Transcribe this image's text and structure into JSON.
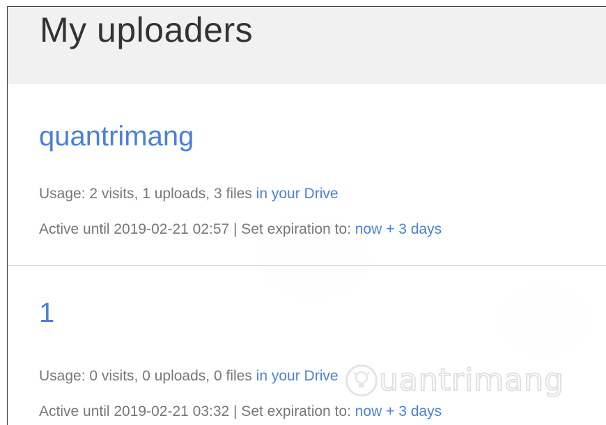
{
  "header": {
    "title": "My uploaders"
  },
  "uploaders": [
    {
      "name": "quantrimang",
      "usage_text": "Usage: 2 visits, 1 uploads, 3 files ",
      "drive_link": "in your Drive",
      "active_text": "Active until 2019-02-21 02:57 | Set expiration to: ",
      "expiration_link": "now + 3 days"
    },
    {
      "name": "1",
      "usage_text": "Usage: 0 visits, 0 uploads, 0 files ",
      "drive_link": "in your Drive",
      "active_text": "Active until 2019-02-21 03:32 | Set expiration to: ",
      "expiration_link": "now + 3 days"
    }
  ],
  "watermark": {
    "text": "uantrimang",
    "icon": "lightbulb-icon"
  },
  "colors": {
    "link": "#4a7fe0",
    "title": "#333333",
    "muted": "#777777",
    "header_bg": "#f1f1f1"
  }
}
